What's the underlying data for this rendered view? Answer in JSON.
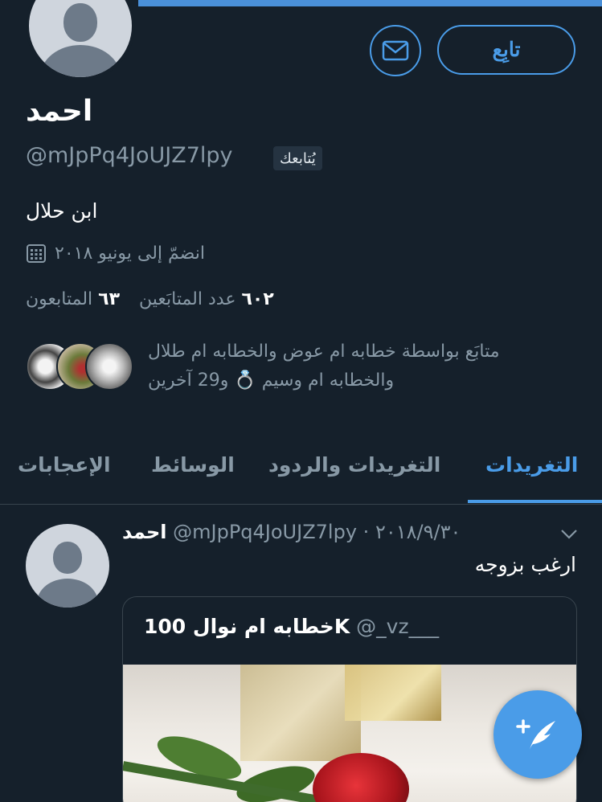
{
  "profile": {
    "name": "احمد",
    "handle": "@mJpPq4JoUJZ7lpy",
    "follows_you": "يُتابعك",
    "bio": "ابن حلال",
    "joined": "انضمّ إلى يونيو ٢٠١٨",
    "following_count": "٦٠٢",
    "following_label": "عدد المتابَعين",
    "followers_count": "٦٣",
    "followers_label": "المتابعون",
    "mutual_line1": "متابَع بواسطة خطابه ام عوض والخطابه ام طلال",
    "mutual_line2": "والخطابه ام وسيم 💍 و29 آخرين"
  },
  "actions": {
    "follow_label": "تابِع"
  },
  "tabs": [
    {
      "label": "التغريدات"
    },
    {
      "label": "التغريدات والردود"
    },
    {
      "label": "الوسائط"
    },
    {
      "label": "الإعجابات"
    }
  ],
  "tweet": {
    "name": "احمد",
    "handle": "@mJpPq4JoUJZ7lpy",
    "date": "٢٠١٨/٩/٣٠",
    "separator": "·",
    "text": "ارغب بزوجه",
    "quote": {
      "handle": "@_vz___",
      "name": "خطابه ام نوال 100K"
    }
  },
  "colors": {
    "background": "#15202b",
    "accent": "#4a9ce8",
    "muted": "#8899a6"
  },
  "icons": [
    "mail-icon",
    "calendar-icon",
    "ring-emoji",
    "chevron-down-icon",
    "compose-tweet-icon"
  ]
}
